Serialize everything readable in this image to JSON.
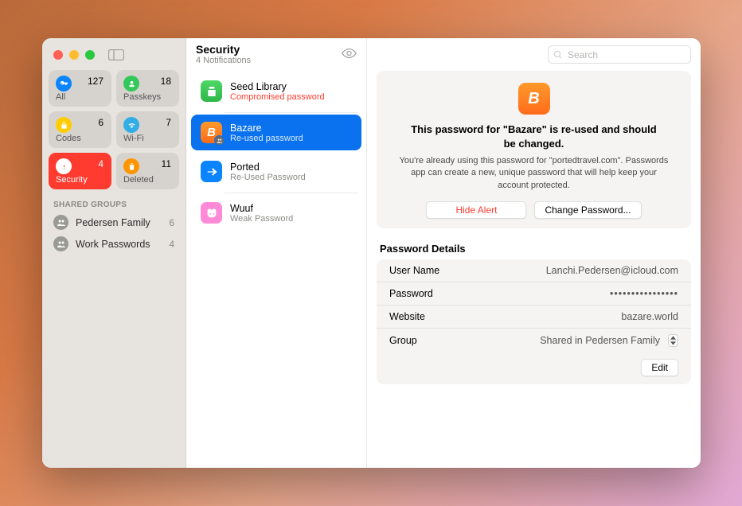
{
  "sidebar": {
    "categories": [
      {
        "label": "All",
        "count": 127
      },
      {
        "label": "Passkeys",
        "count": 18
      },
      {
        "label": "Codes",
        "count": 6
      },
      {
        "label": "Wi-Fi",
        "count": 7
      },
      {
        "label": "Security",
        "count": 4
      },
      {
        "label": "Deleted",
        "count": 11
      }
    ],
    "shared_header": "SHARED GROUPS",
    "groups": [
      {
        "label": "Pedersen Family",
        "count": 6
      },
      {
        "label": "Work Passwords",
        "count": 4
      }
    ]
  },
  "mid": {
    "title": "Security",
    "subtitle": "4 Notifications",
    "items": [
      {
        "name": "Seed Library",
        "note": "Compromised password",
        "note_red": true
      },
      {
        "name": "Bazare",
        "note": "Re-used password",
        "note_red": false
      },
      {
        "name": "Ported",
        "note": "Re-Used Password",
        "note_red": false
      },
      {
        "name": "Wuuf",
        "note": "Weak Password",
        "note_red": false
      }
    ]
  },
  "search": {
    "placeholder": "Search"
  },
  "alert": {
    "title": "This password for \"Bazare\" is re-used and should be changed.",
    "body": "You're already using this password for \"portedtravel.com\". Passwords app can create a new, unique password that will help keep your account protected.",
    "hide_label": "Hide Alert",
    "change_label": "Change Password..."
  },
  "details": {
    "header": "Password Details",
    "rows": {
      "username_k": "User Name",
      "username_v": "Lanchi.Pedersen@icloud.com",
      "password_k": "Password",
      "password_v": "••••••••••••••••",
      "website_k": "Website",
      "website_v": "bazare.world",
      "group_k": "Group",
      "group_v": "Shared in Pedersen Family"
    },
    "edit_label": "Edit"
  }
}
